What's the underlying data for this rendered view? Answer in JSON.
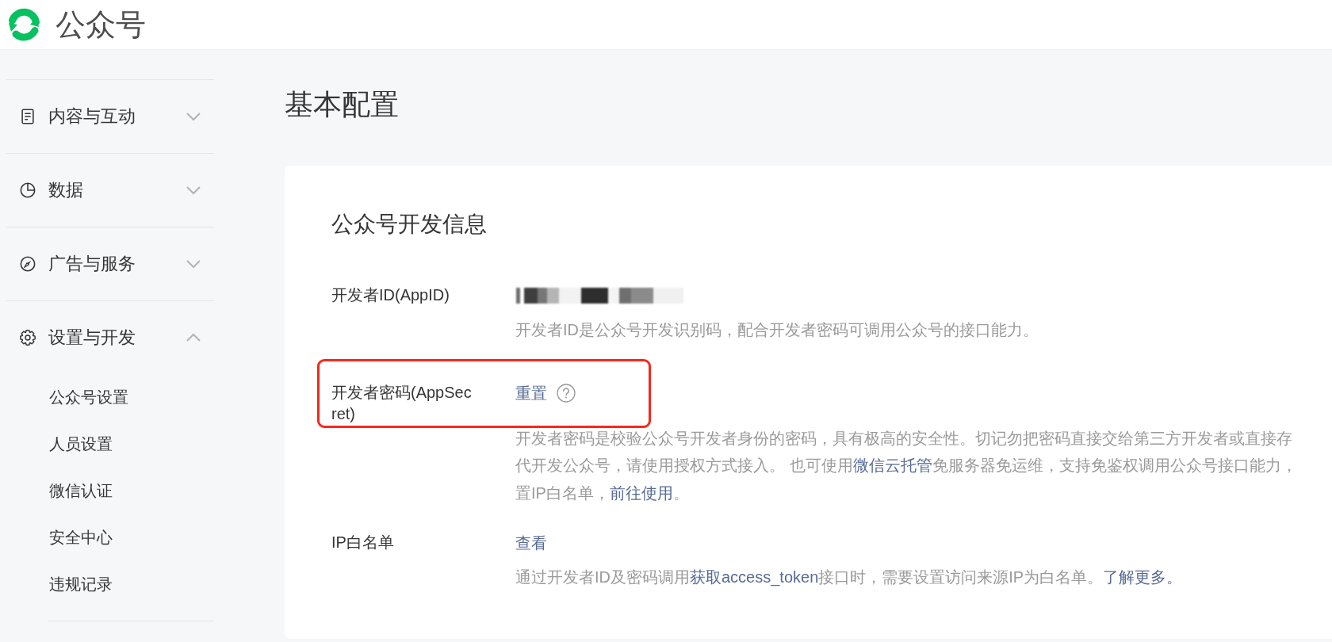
{
  "header": {
    "title": "公众号"
  },
  "sidebar": {
    "groups": [
      {
        "label": "内容与互动",
        "expanded": false
      },
      {
        "label": "数据",
        "expanded": false
      },
      {
        "label": "广告与服务",
        "expanded": false
      },
      {
        "label": "设置与开发",
        "expanded": true,
        "children": [
          {
            "label": "公众号设置",
            "selected": false
          },
          {
            "label": "人员设置",
            "selected": false
          },
          {
            "label": "微信认证",
            "selected": false
          },
          {
            "label": "安全中心",
            "selected": false
          },
          {
            "label": "违规记录",
            "selected": false
          }
        ]
      }
    ]
  },
  "page": {
    "title": "基本配置",
    "card": {
      "title": "公众号开发信息",
      "rows": [
        {
          "label": "开发者ID(AppID)",
          "highlighted": false,
          "value": {
            "kind": "redacted"
          },
          "description": [
            [
              {
                "text": "开发者ID是公众号开发识别码，配合开发者密码可调用公众号的接口能力。",
                "link": false
              }
            ]
          ]
        },
        {
          "label": "开发者密码(AppSecret)",
          "highlighted": true,
          "value": {
            "kind": "link",
            "text": "重置",
            "help": true
          },
          "description": [
            [
              {
                "text": "开发者密码是校验公众号开发者身份的密码，具有极高的安全性。切记勿把密码直接交给第三方开发者或直接存",
                "link": false
              }
            ],
            [
              {
                "text": "代开发公众号，请使用授权方式接入。 也可使用",
                "link": false
              },
              {
                "text": "微信云托管",
                "link": true
              },
              {
                "text": "免服务器免运维，支持免鉴权调用公众号接口能力，",
                "link": false
              }
            ],
            [
              {
                "text": "置IP白名单，",
                "link": false
              },
              {
                "text": "前往使用",
                "link": true
              },
              {
                "text": "。",
                "link": false
              }
            ]
          ]
        },
        {
          "label": "IP白名单",
          "highlighted": false,
          "value": {
            "kind": "link",
            "text": "查看",
            "help": false
          },
          "description": [
            [
              {
                "text": "通过开发者ID及密码调用",
                "link": false
              },
              {
                "text": "获取access_token",
                "link": true
              },
              {
                "text": "接口时，需要设置访问来源IP为白名单。",
                "link": false
              },
              {
                "text": "了解更多。",
                "link": true
              }
            ]
          ]
        }
      ]
    }
  }
}
